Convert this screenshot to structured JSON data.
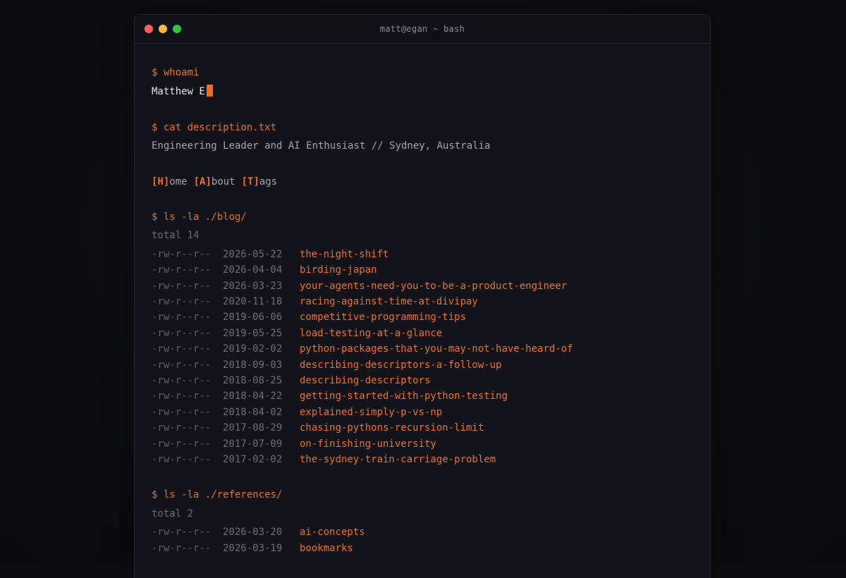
{
  "window": {
    "title": "matt@egan ~ bash",
    "dots": [
      {
        "name": "close",
        "color": "#ff5f57"
      },
      {
        "name": "minimize",
        "color": "#febc2e"
      },
      {
        "name": "maximize",
        "color": "#28c840"
      }
    ]
  },
  "whoami": {
    "command": "$ whoami",
    "output": "Matthew E"
  },
  "description": {
    "command": "$ cat description.txt",
    "output": "Engineering Leader and AI Enthusiast // Sydney, Australia"
  },
  "nav": [
    {
      "key": "[H]",
      "rest": "ome"
    },
    {
      "key": "[A]",
      "rest": "bout"
    },
    {
      "key": "[T]",
      "rest": "ags"
    }
  ],
  "blog": {
    "command": "$ ls -la ./blog/",
    "total": "total 14",
    "entries": [
      {
        "perm": "-rw-r--r--",
        "date": "2026-05-22",
        "name": "the-night-shift"
      },
      {
        "perm": "-rw-r--r--",
        "date": "2026-04-04",
        "name": "birding-japan"
      },
      {
        "perm": "-rw-r--r--",
        "date": "2026-03-23",
        "name": "your-agents-need-you-to-be-a-product-engineer"
      },
      {
        "perm": "-rw-r--r--",
        "date": "2020-11-18",
        "name": "racing-against-time-at-divipay"
      },
      {
        "perm": "-rw-r--r--",
        "date": "2019-06-06",
        "name": "competitive-programming-tips"
      },
      {
        "perm": "-rw-r--r--",
        "date": "2019-05-25",
        "name": "load-testing-at-a-glance"
      },
      {
        "perm": "-rw-r--r--",
        "date": "2019-02-02",
        "name": "python-packages-that-you-may-not-have-heard-of"
      },
      {
        "perm": "-rw-r--r--",
        "date": "2018-09-03",
        "name": "describing-descriptors-a-follow-up"
      },
      {
        "perm": "-rw-r--r--",
        "date": "2018-08-25",
        "name": "describing-descriptors"
      },
      {
        "perm": "-rw-r--r--",
        "date": "2018-04-22",
        "name": "getting-started-with-python-testing"
      },
      {
        "perm": "-rw-r--r--",
        "date": "2018-04-02",
        "name": "explained-simply-p-vs-np"
      },
      {
        "perm": "-rw-r--r--",
        "date": "2017-08-29",
        "name": "chasing-pythons-recursion-limit"
      },
      {
        "perm": "-rw-r--r--",
        "date": "2017-07-09",
        "name": "on-finishing-university"
      },
      {
        "perm": "-rw-r--r--",
        "date": "2017-02-02",
        "name": "the-sydney-train-carriage-problem"
      }
    ]
  },
  "references": {
    "command": "$ ls -la ./references/",
    "total": "total 2",
    "entries": [
      {
        "perm": "-rw-r--r--",
        "date": "2026-03-20",
        "name": "ai-concepts"
      },
      {
        "perm": "-rw-r--r--",
        "date": "2026-03-19",
        "name": "bookmarks"
      }
    ]
  },
  "colors": {
    "accent": "#f07020",
    "cursor": "#f26a1b",
    "background": "#12131a"
  }
}
